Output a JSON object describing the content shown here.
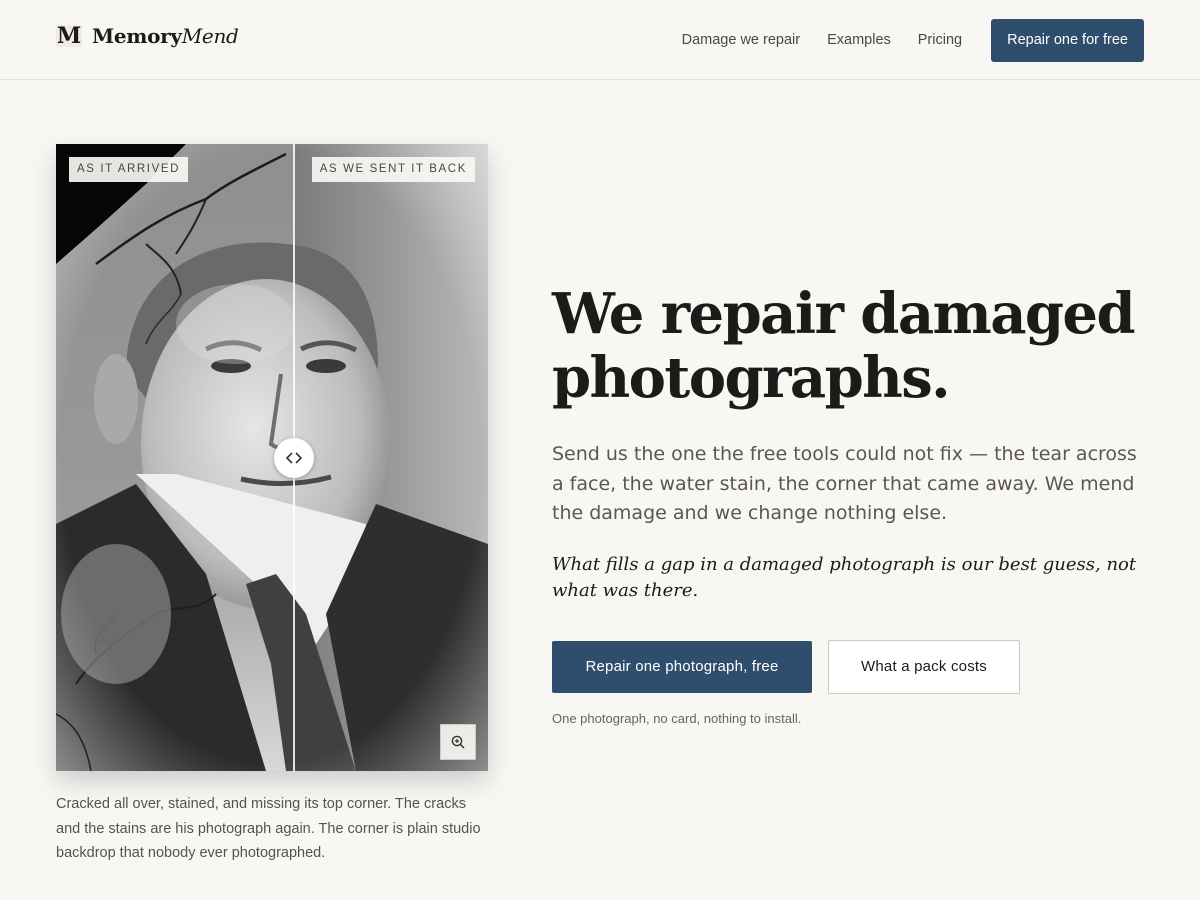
{
  "brand": {
    "mark": "M",
    "name_regular": "Memory",
    "name_italic": "Mend"
  },
  "nav": {
    "links": [
      "Damage we repair",
      "Examples",
      "Pricing"
    ],
    "cta": "Repair one for free"
  },
  "compare": {
    "before_label": "AS IT ARRIVED",
    "after_label": "AS WE SENT IT BACK",
    "caption": "Cracked all over, stained, and missing its top corner. The cracks and the stains are his photograph again. The corner is plain studio backdrop that nobody ever photographed."
  },
  "hero": {
    "title": "We repair damaged photographs.",
    "lede": "Send us the one the free tools could not fix — the tear across a face, the water stain, the corner that came away. We mend the damage and we change nothing else.",
    "note": "What fills a gap in a damaged photograph is our best guess, not what was there.",
    "primary_button": "Repair one photograph, free",
    "secondary_button": "What a pack costs",
    "fineprint": "One photograph, no card, nothing to install."
  },
  "icons": {
    "logo": "m-monogram-icon",
    "compare_handle": "chevrons-left-right-icon",
    "zoom": "zoom-in-icon"
  },
  "colors": {
    "accent": "#2f4d6c",
    "background": "#f9f7f4",
    "text": "#1c1b19"
  }
}
